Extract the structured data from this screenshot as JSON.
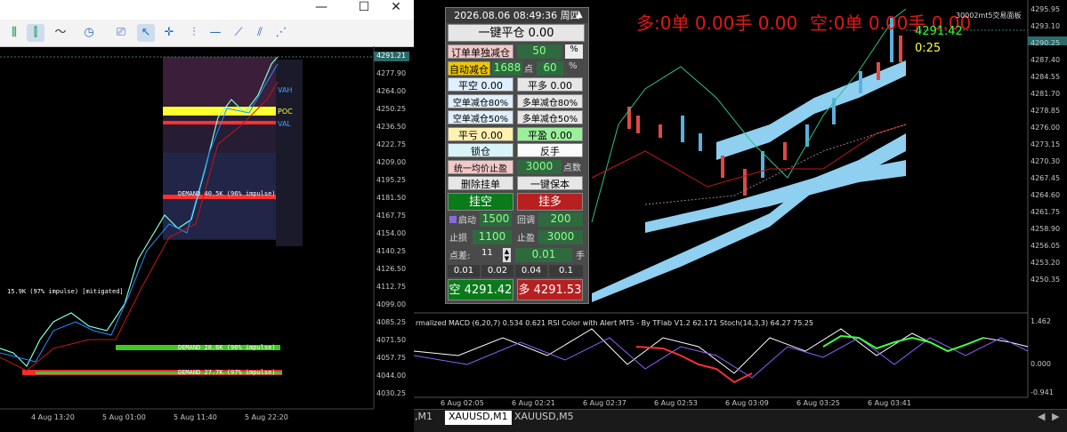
{
  "left_window": {
    "title_buttons": {
      "minimize": "—",
      "maximize": "☐",
      "close": "✕"
    },
    "price_axis": [
      "4291.21",
      "4277.90",
      "4264.00",
      "4250.25",
      "4236.50",
      "4222.75",
      "4209.00",
      "4195.25",
      "4181.50",
      "4167.75",
      "4154.00",
      "4140.25",
      "4126.50",
      "4112.75",
      "4099.00",
      "4085.25",
      "4071.50",
      "4057.75",
      "4044.00",
      "4030.25"
    ],
    "time_axis": [
      "4 Aug 13:20",
      "5 Aug 01:00",
      "5 Aug 11:40",
      "5 Aug 22:20"
    ],
    "labels": {
      "vah": "VAH",
      "poc": "POC",
      "val": "VAL",
      "demand1": "DEMAND  40.5K (96% impulse)",
      "demand2": "DEMAND  28.6K (96% impulse)",
      "demand3": "DEMAND  27.7K (97% impulse)",
      "mitigated": "15.9K (97% impulse)  [mitigated]"
    }
  },
  "panel": {
    "datetime": "2026.08.06 08:49:36 周四",
    "close_all": "一键平仓 0.00",
    "order_reduce_label": "订单单独减仓",
    "order_reduce_val": "50",
    "pct1": "%",
    "auto_reduce_label": "自动减仓",
    "auto_reduce_pts": "1688",
    "pts_unit": "点",
    "auto_reduce_pct": "60",
    "pct2": "%",
    "close_short": "平空 0.00",
    "close_long": "平多 0.00",
    "short_reduce80": "空单减仓80%",
    "long_reduce80": "多单减仓80%",
    "short_reduce50": "空单减仓50%",
    "long_reduce50": "多单减仓50%",
    "close_loss": "平亏 0.00",
    "close_profit": "平盈 0.00",
    "lock": "锁仓",
    "reverse": "反手",
    "unify_sl_label": "统一均价止盈",
    "unify_sl_val": "3000",
    "unify_sl_unit": "点数",
    "delete_pending": "删除挂单",
    "breakeven": "一键保本",
    "pending_short": "挂空",
    "pending_long": "挂多",
    "start_label": "启动",
    "start_val": "1500",
    "pullback_label": "回调",
    "pullback_val": "200",
    "sl_label": "止损",
    "sl_val": "1100",
    "tp_label": "止盈",
    "tp_val": "3000",
    "spread_label": "点差:",
    "spread_val": "11",
    "lot_val": "0.01",
    "lot_unit": "手",
    "lots": [
      "0.01",
      "0.02",
      "0.04",
      "0.1"
    ],
    "sell_btn": "空 4291.42",
    "buy_btn": "多 4291.53"
  },
  "right_chart": {
    "long_status": "多:0单 0.00手 0.00",
    "short_status": "空:0单 0.00手 0.00",
    "brand": "30002mt5交易面板",
    "price_tag": "4291.42",
    "countdown": "0:25",
    "price_axis": [
      "4295.95",
      "4293.10",
      "4290.25",
      "4287.40",
      "4284.55",
      "4281.70",
      "4278.85",
      "4276.00",
      "4273.15",
      "4270.30",
      "4267.45",
      "4264.60",
      "4261.75",
      "4258.90",
      "4256.05",
      "4253.20",
      "4250.35"
    ],
    "time_axis": [
      "6 Aug 02:05",
      "6 Aug 02:21",
      "6 Aug 02:37",
      "6 Aug 02:53",
      "6 Aug 03:09",
      "6 Aug 03:25",
      "6 Aug 03:41"
    ],
    "indicator_label": "rmalized MACD (6,20,7) 0.534 0.621 RSI Color with Alert MT5 - By TFlab V1.2 62.171 Stoch(14,3,3) 64.27 75.25",
    "osc_axis": [
      "1.462",
      "0.000",
      "-0.941"
    ]
  },
  "tabs": [
    ",M1",
    "XAUUSD,M1",
    "XAUUSD,M5"
  ],
  "colors": {
    "accent": "#00c000",
    "danger": "#e01818",
    "panel_bg": "#4a4a4a"
  }
}
